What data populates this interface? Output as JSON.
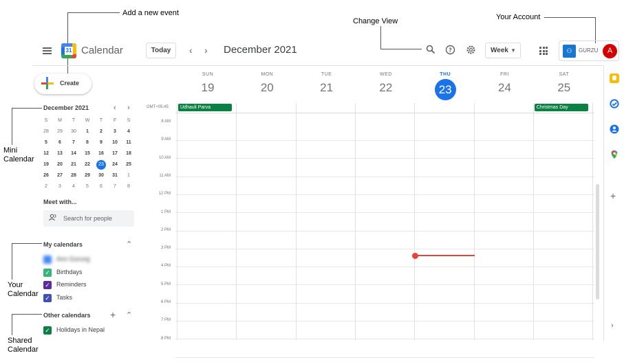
{
  "annotations": {
    "add_event": "Add a new event",
    "change_view": "Change View",
    "your_account": "Your Account",
    "mini_calendar": "Mini\nCalendar",
    "your_calendar": "Your\nCalendar",
    "shared_calendar": "Shared\nCalendar"
  },
  "header": {
    "app_title": "Calendar",
    "logo_digit": "31",
    "today_label": "Today",
    "prev_icon": "chevron-left-icon",
    "next_icon": "chevron-right-icon",
    "month": "December 2021",
    "view_label": "Week",
    "org_name": "GURZU",
    "avatar_letter": "A"
  },
  "create": {
    "label": "Create"
  },
  "mini_calendar": {
    "title": "December 2021",
    "dow": [
      "S",
      "M",
      "T",
      "W",
      "T",
      "F",
      "S"
    ],
    "weeks": [
      [
        "28",
        "29",
        "30",
        "1",
        "2",
        "3",
        "4"
      ],
      [
        "5",
        "6",
        "7",
        "8",
        "9",
        "10",
        "11"
      ],
      [
        "12",
        "13",
        "14",
        "15",
        "16",
        "17",
        "18"
      ],
      [
        "19",
        "20",
        "21",
        "22",
        "23",
        "24",
        "25"
      ],
      [
        "26",
        "27",
        "28",
        "29",
        "30",
        "31",
        "1"
      ],
      [
        "2",
        "3",
        "4",
        "5",
        "6",
        "7",
        "8"
      ]
    ],
    "selected": "23"
  },
  "meet": {
    "title": "Meet with...",
    "placeholder": "Search for people"
  },
  "my_calendars": {
    "title": "My calendars",
    "items": [
      {
        "name": "Ann Gurung",
        "color": "#4285f4",
        "blurred": true
      },
      {
        "name": "Birthdays",
        "color": "#33b679"
      },
      {
        "name": "Reminders",
        "color": "#5b2c9e"
      },
      {
        "name": "Tasks",
        "color": "#3f51b5"
      }
    ]
  },
  "other_calendars": {
    "title": "Other calendars",
    "items": [
      {
        "name": "Holidays in Nepal",
        "color": "#0b8043"
      }
    ]
  },
  "week": {
    "days": [
      {
        "name": "SUN",
        "date": "19"
      },
      {
        "name": "MON",
        "date": "20"
      },
      {
        "name": "TUE",
        "date": "21"
      },
      {
        "name": "WED",
        "date": "22"
      },
      {
        "name": "THU",
        "date": "23",
        "today": true
      },
      {
        "name": "FRI",
        "date": "24"
      },
      {
        "name": "SAT",
        "date": "25"
      }
    ],
    "timezone": "GMT+05:45",
    "times": [
      "8 AM",
      "9 AM",
      "10 AM",
      "11 AM",
      "12 PM",
      "1 PM",
      "2 PM",
      "3 PM",
      "4 PM",
      "5 PM",
      "6 PM",
      "7 PM",
      "8 PM"
    ],
    "all_day_events": [
      {
        "title": "Udhauli Parva",
        "day": 0
      },
      {
        "title": "Christmas Day",
        "day": 6
      }
    ]
  }
}
